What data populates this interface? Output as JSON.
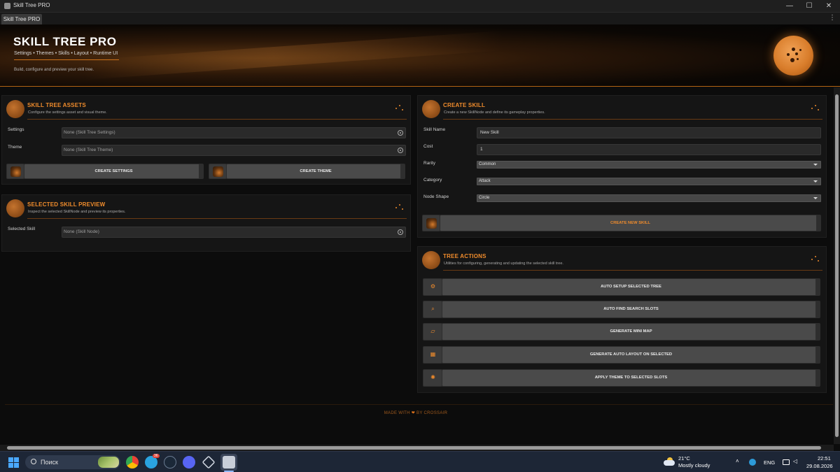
{
  "window": {
    "title": "Skill Tree PRO",
    "controls": {
      "minimize": "—",
      "maximize": "☐",
      "close": "✕"
    }
  },
  "tab": {
    "label": "Skill Tree PRO",
    "menu_icon": "⋮"
  },
  "header": {
    "title": "SKILL TREE PRO",
    "breadcrumbs": "Settings • Themes • Skills • Layout • Runtime UI",
    "subtitle": "Build, configure and preview your skill tree."
  },
  "assets_panel": {
    "title": "SKILL TREE ASSETS",
    "description": "Configure the settings asset and visual theme.",
    "settings_label": "Settings",
    "settings_value": "None (Skill Tree Settings)",
    "theme_label": "Theme",
    "theme_value": "None (Skill Tree Theme)",
    "create_settings": "CREATE SETTINGS",
    "create_theme": "CREATE THEME"
  },
  "preview_panel": {
    "title": "SELECTED SKILL PREVIEW",
    "description": "Inspect the selected SkillNode and preview its properties.",
    "selected_label": "Selected Skill",
    "selected_value": "None (Skill Node)"
  },
  "create_panel": {
    "title": "CREATE SKILL",
    "description": "Create a new SkillNode and define its gameplay properties.",
    "fields": {
      "name_label": "Skill Name",
      "name_value": "New Skill",
      "cost_label": "Cost",
      "cost_value": "1",
      "rarity_label": "Rarity",
      "rarity_value": "Common",
      "category_label": "Category",
      "category_value": "Attack",
      "shape_label": "Node Shape",
      "shape_value": "Circle"
    },
    "create_button": "CREATE NEW SKILL"
  },
  "actions_panel": {
    "title": "TREE ACTIONS",
    "description": "Utilities for configuring, generating and updating the selected skill tree.",
    "actions": [
      {
        "label": "AUTO SETUP SELECTED TREE",
        "icon": "gear-icon",
        "glyph": "⚙"
      },
      {
        "label": "AUTO FIND SEARCH SLOTS",
        "icon": "search-icon",
        "glyph": "⌕"
      },
      {
        "label": "GENERATE MINI MAP",
        "icon": "map-icon",
        "glyph": "▱"
      },
      {
        "label": "GENERATE AUTO LAYOUT ON SELECTED",
        "icon": "grid-icon",
        "glyph": "▦"
      },
      {
        "label": "APPLY THEME TO SELECTED SLOTS",
        "icon": "sun-icon",
        "glyph": "✺"
      }
    ]
  },
  "footer": {
    "made_with": "MADE WITH",
    "heart": "❤",
    "by": "BY CROSSAIR"
  },
  "taskbar": {
    "search_placeholder": "Поиск",
    "telegram_badge": "36",
    "temperature": "21°C",
    "weather": "Mostly cloudy",
    "language": "ENG",
    "time": "22:51",
    "date": "29.08.2026",
    "colors": {
      "accent": "#f08c2c",
      "brand_dark": "#151515",
      "taskbar": "#1d2636"
    }
  }
}
